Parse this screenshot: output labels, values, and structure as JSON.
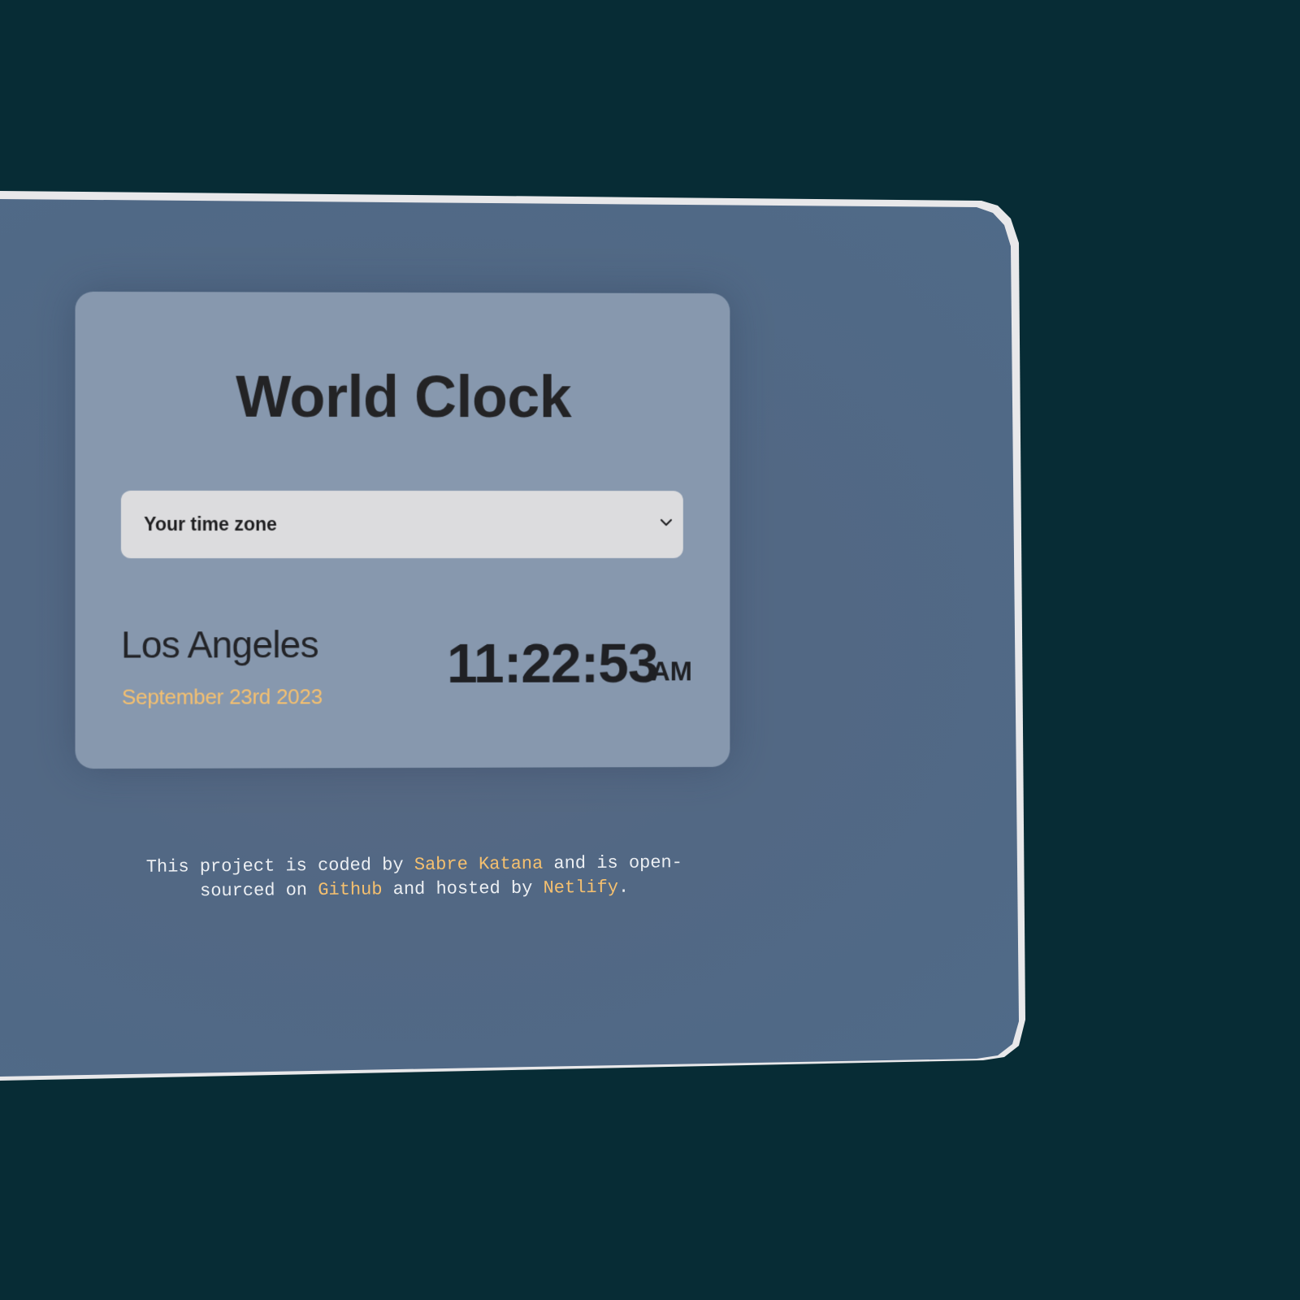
{
  "app": {
    "title": "World Clock"
  },
  "timezone_select": {
    "selected": "Your time zone",
    "icon": "chevron-down-icon"
  },
  "clock": {
    "city": "Los Angeles",
    "date": "September 23rd 2023",
    "time": "11:22:53",
    "period": "AM"
  },
  "footer": {
    "text_1": "This project is coded by ",
    "author": "Sabre Katana",
    "text_2": " and is open-sourced on ",
    "github": "Github",
    "text_3": " and hosted by ",
    "netlify": "Netlify",
    "text_4": "."
  },
  "colors": {
    "background": "#072c35",
    "card": "#8798ae",
    "accent": "#f5c06f",
    "select_bg": "#dcdcde"
  }
}
